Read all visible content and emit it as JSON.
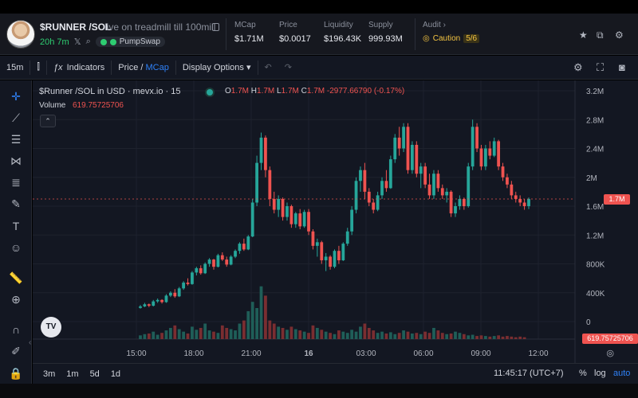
{
  "header": {
    "token_name": "$RUNNER /SOL",
    "token_desc": "live on treadmill till 100mill",
    "age": "20h 7m",
    "dex_label": "PumpSwap",
    "stats": [
      {
        "label": "MCap",
        "value": "$1.71M"
      },
      {
        "label": "Price",
        "value": "$0.0017"
      },
      {
        "label": "Liquidity",
        "value": "$196.43K"
      },
      {
        "label": "Supply",
        "value": "999.93M"
      }
    ],
    "audit_label": "Audit",
    "caution_label": "Caution",
    "caution_score": "5/6"
  },
  "toolbar": {
    "interval": "15m",
    "indicators": "Indicators",
    "price_label": "Price /",
    "mcap_label": "MCap",
    "display_options": "Display Options"
  },
  "chart_legend": {
    "title": "$Runner /SOL in USD · mevx.io · 15",
    "ohlc": [
      {
        "k": "O",
        "v": "1.7M"
      },
      {
        "k": "H",
        "v": "1.7M"
      },
      {
        "k": "L",
        "v": "1.7M"
      },
      {
        "k": "C",
        "v": "1.7M"
      }
    ],
    "change": "-2977.66790 (-0.17%)",
    "volume_label": "Volume",
    "volume_value": "619.75725706"
  },
  "chart_data": {
    "type": "candlestick",
    "y_axis_ticks": [
      "3.2M",
      "2.8M",
      "2.4M",
      "2M",
      "1.6M",
      "1.2M",
      "800K",
      "400K",
      "0"
    ],
    "ylim": [
      0,
      3200000
    ],
    "x_axis_ticks": [
      "15:00",
      "18:00",
      "21:00",
      "16",
      "03:00",
      "06:00",
      "09:00",
      "12:00"
    ],
    "current_price_label": "1.7M",
    "current_price": 1700000,
    "volume_tag": "619.75725706",
    "candles": [
      [
        190000,
        230000,
        180000,
        210000
      ],
      [
        210000,
        260000,
        200000,
        240000
      ],
      [
        240000,
        250000,
        200000,
        220000
      ],
      [
        220000,
        300000,
        210000,
        280000
      ],
      [
        280000,
        320000,
        260000,
        300000
      ],
      [
        300000,
        310000,
        250000,
        270000
      ],
      [
        270000,
        380000,
        260000,
        360000
      ],
      [
        360000,
        420000,
        340000,
        400000
      ],
      [
        400000,
        450000,
        330000,
        350000
      ],
      [
        350000,
        480000,
        340000,
        460000
      ],
      [
        460000,
        560000,
        440000,
        540000
      ],
      [
        540000,
        600000,
        500000,
        520000
      ],
      [
        520000,
        700000,
        510000,
        680000
      ],
      [
        680000,
        760000,
        640000,
        740000
      ],
      [
        740000,
        780000,
        650000,
        670000
      ],
      [
        670000,
        820000,
        660000,
        800000
      ],
      [
        800000,
        880000,
        760000,
        860000
      ],
      [
        860000,
        870000,
        720000,
        760000
      ],
      [
        760000,
        940000,
        750000,
        920000
      ],
      [
        920000,
        960000,
        840000,
        860000
      ],
      [
        860000,
        900000,
        760000,
        790000
      ],
      [
        790000,
        920000,
        780000,
        900000
      ],
      [
        900000,
        1000000,
        880000,
        980000
      ],
      [
        980000,
        1100000,
        940000,
        1080000
      ],
      [
        1080000,
        1150000,
        980000,
        1000000
      ],
      [
        1000000,
        1200000,
        990000,
        1180000
      ],
      [
        1180000,
        1700000,
        1170000,
        1650000
      ],
      [
        1650000,
        2300000,
        1600000,
        2200000
      ],
      [
        2200000,
        2620000,
        2100000,
        2550000
      ],
      [
        2550000,
        2580000,
        2000000,
        2100000
      ],
      [
        2100000,
        2150000,
        1600000,
        1700000
      ],
      [
        1700000,
        1800000,
        1500000,
        1550000
      ],
      [
        1550000,
        1750000,
        1450000,
        1700000
      ],
      [
        1700000,
        1720000,
        1400000,
        1450000
      ],
      [
        1450000,
        1650000,
        1400000,
        1600000
      ],
      [
        1600000,
        1620000,
        1300000,
        1350000
      ],
      [
        1350000,
        1520000,
        1300000,
        1500000
      ],
      [
        1500000,
        1560000,
        1280000,
        1320000
      ],
      [
        1320000,
        1550000,
        1300000,
        1520000
      ],
      [
        1520000,
        1560000,
        1200000,
        1250000
      ],
      [
        1250000,
        1280000,
        1000000,
        1050000
      ],
      [
        1050000,
        1150000,
        900000,
        1100000
      ],
      [
        1100000,
        1120000,
        800000,
        850000
      ],
      [
        850000,
        950000,
        700000,
        900000
      ],
      [
        900000,
        920000,
        720000,
        760000
      ],
      [
        760000,
        1000000,
        740000,
        980000
      ],
      [
        980000,
        1050000,
        800000,
        850000
      ],
      [
        850000,
        1100000,
        840000,
        1080000
      ],
      [
        1080000,
        1300000,
        1050000,
        1250000
      ],
      [
        1250000,
        1600000,
        1200000,
        1550000
      ],
      [
        1550000,
        2000000,
        1500000,
        1950000
      ],
      [
        1950000,
        2150000,
        1800000,
        2100000
      ],
      [
        2100000,
        2200000,
        1700000,
        1800000
      ],
      [
        1800000,
        1850000,
        1600000,
        1650000
      ],
      [
        1650000,
        1700000,
        1500000,
        1550000
      ],
      [
        1550000,
        1800000,
        1530000,
        1750000
      ],
      [
        1750000,
        2000000,
        1700000,
        1950000
      ],
      [
        1950000,
        2100000,
        1800000,
        1850000
      ],
      [
        1850000,
        2300000,
        1840000,
        2250000
      ],
      [
        2250000,
        2600000,
        2200000,
        2550000
      ],
      [
        2550000,
        2700000,
        2300000,
        2400000
      ],
      [
        2400000,
        2750000,
        2350000,
        2700000
      ],
      [
        2700000,
        2750000,
        2050000,
        2100000
      ],
      [
        2100000,
        2500000,
        2050000,
        2450000
      ],
      [
        2450000,
        2500000,
        2000000,
        2050000
      ],
      [
        2050000,
        2200000,
        1850000,
        2150000
      ],
      [
        2150000,
        2200000,
        1850000,
        1900000
      ],
      [
        1900000,
        2050000,
        1700000,
        1750000
      ],
      [
        1750000,
        2100000,
        1700000,
        2050000
      ],
      [
        2050000,
        2100000,
        1800000,
        1850000
      ],
      [
        1850000,
        1900000,
        1700000,
        1750000
      ],
      [
        1750000,
        1850000,
        1650000,
        1800000
      ],
      [
        1800000,
        1820000,
        1450000,
        1500000
      ],
      [
        1500000,
        1650000,
        1450000,
        1600000
      ],
      [
        1600000,
        1750000,
        1550000,
        1700000
      ],
      [
        1700000,
        1720000,
        1550000,
        1600000
      ],
      [
        1600000,
        2200000,
        1580000,
        2150000
      ],
      [
        2150000,
        2800000,
        2100000,
        2700000
      ],
      [
        2700000,
        2750000,
        2350000,
        2400000
      ],
      [
        2400000,
        2450000,
        2100000,
        2150000
      ],
      [
        2150000,
        2450000,
        2100000,
        2400000
      ],
      [
        2400000,
        2500000,
        2250000,
        2300000
      ],
      [
        2300000,
        2550000,
        2280000,
        2500000
      ],
      [
        2500000,
        2520000,
        2100000,
        2150000
      ],
      [
        2150000,
        2200000,
        1950000,
        2000000
      ],
      [
        2000000,
        2050000,
        1850000,
        1900000
      ],
      [
        1900000,
        1950000,
        1700000,
        1750000
      ],
      [
        1750000,
        1800000,
        1650000,
        1700000
      ],
      [
        1700000,
        1750000,
        1600000,
        1650000
      ],
      [
        1650000,
        1700000,
        1550000,
        1600000
      ],
      [
        1600000,
        1720000,
        1560000,
        1700000
      ]
    ],
    "volume_ylim": [
      0,
      100
    ],
    "volumes": [
      6,
      8,
      9,
      12,
      7,
      10,
      14,
      18,
      22,
      16,
      12,
      9,
      20,
      15,
      18,
      25,
      14,
      12,
      10,
      22,
      18,
      16,
      14,
      25,
      30,
      45,
      60,
      50,
      85,
      70,
      30,
      25,
      20,
      18,
      15,
      20,
      16,
      14,
      12,
      10,
      22,
      18,
      15,
      12,
      10,
      8,
      14,
      12,
      10,
      15,
      12,
      20,
      25,
      18,
      14,
      10,
      12,
      9,
      11,
      8,
      10,
      14,
      12,
      9,
      10,
      8,
      12,
      10,
      18,
      14,
      10,
      8,
      9,
      12,
      10,
      8,
      6,
      7,
      5,
      6,
      5,
      4,
      5,
      6,
      4,
      5,
      4,
      3,
      4,
      3
    ]
  },
  "bottom": {
    "ranges": [
      "3m",
      "1m",
      "5d",
      "1d"
    ],
    "clock": "11:45:17 (UTC+7)",
    "percent": "%",
    "log": "log",
    "auto": "auto"
  }
}
